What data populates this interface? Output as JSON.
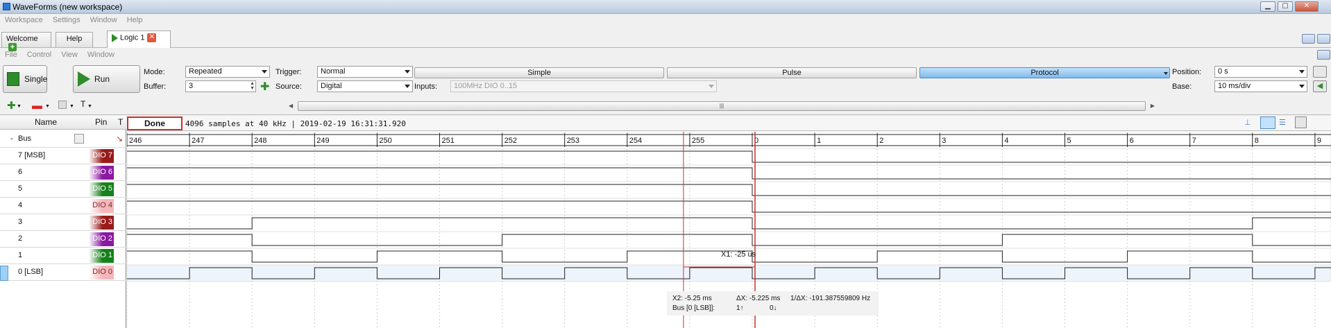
{
  "window": {
    "title": "WaveForms (new workspace)"
  },
  "menu_main": [
    "Workspace",
    "Settings",
    "Window",
    "Help"
  ],
  "tabs": [
    {
      "label": "Welcome",
      "icon": "plus-icon"
    },
    {
      "label": "Help"
    },
    {
      "label": "Logic 1",
      "icon": "play-icon",
      "close": "close-icon",
      "active": true
    }
  ],
  "menu_instrument": [
    "File",
    "Control",
    "View",
    "Window"
  ],
  "toolbar": {
    "single_label": "Single",
    "run_label": "Run",
    "mode_label": "Mode:",
    "mode_value": "Repeated",
    "buffer_label": "Buffer:",
    "buffer_value": "3",
    "trigger_label": "Trigger:",
    "trigger_value": "Normal",
    "source_label": "Source:",
    "source_value": "Digital",
    "inputs_label": "Inputs:",
    "inputs_value": "100MHz DIO 0..15",
    "trigger_types": [
      "Simple",
      "Pulse",
      "Protocol"
    ],
    "active_trigger_type": "Protocol",
    "position_label": "Position:",
    "position_value": "0 s",
    "base_label": "Base:",
    "base_value": "10 ms/div"
  },
  "scrollbar_grip": "|||",
  "add_menu_label": "T",
  "signal_panel": {
    "headers": {
      "name": "Name",
      "pin": "Pin",
      "trigger": "T"
    },
    "bus_label": "Bus",
    "bus_toggle": "-",
    "signals": [
      {
        "name": "7 [MSB]",
        "pin": "DIO 7",
        "color": "#9a1a1a"
      },
      {
        "name": "6",
        "pin": "DIO 6",
        "color": "#8a1aa0"
      },
      {
        "name": "5",
        "pin": "DIO 5",
        "color": "#16801a"
      },
      {
        "name": "4",
        "pin": "DIO 4",
        "color": "#f4b6bb"
      },
      {
        "name": "3",
        "pin": "DIO 3",
        "color": "#9a1a1a"
      },
      {
        "name": "2",
        "pin": "DIO 2",
        "color": "#8a1aa0"
      },
      {
        "name": "1",
        "pin": "DIO 1",
        "color": "#16801a"
      },
      {
        "name": "0 [LSB]",
        "pin": "DIO 0",
        "color": "#f4b6bb"
      }
    ]
  },
  "status": {
    "state": "Done",
    "text": "4096 samples at 40 kHz | 2019-02-19 16:31:31.920"
  },
  "bus_values": [
    "246",
    "247",
    "248",
    "249",
    "250",
    "251",
    "252",
    "253",
    "254",
    "255",
    "0",
    "1",
    "2",
    "3",
    "4",
    "5",
    "6",
    "7",
    "8",
    "9"
  ],
  "cursor_x1_label": "X1: -25 us",
  "measurements": {
    "x2": "X2: -5.25 ms",
    "dx": "ΔX: -5.225 ms",
    "inv_dx": "1/ΔX: -191.387559809 Hz",
    "bus_label": "Bus [0 [LSB]]:",
    "rising": "1↑",
    "falling": "0↓"
  },
  "colors": {
    "cursor": "#c8312c",
    "accent": "#7fbbec"
  }
}
